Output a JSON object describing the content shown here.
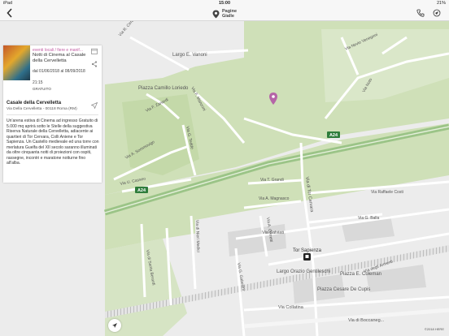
{
  "status_bar": {
    "carrier": "iPad",
    "time": "15:00",
    "battery": "21%"
  },
  "nav": {
    "logo_line1": "Pagine",
    "logo_line2": "Gialle"
  },
  "event_card": {
    "category": "eventi locali / fiere e manif...",
    "title": "Notti di Cinema al Casale della Cervelletta",
    "dates": "dal 01/06/2018 al 08/09/2018",
    "time": "21:15",
    "price": "GRATUITO",
    "venue_name": "Casale della Cervelletta",
    "venue_address": "Via Della Cervelletta - 00118 Roma (RM)",
    "description": "Un'arena estiva di Cinema ad ingresso Gratuito di 5.000 mq aprirà sotto le Stelle della suggestiva Riserva Naturale della Cervelletta, adiacente ai quartieri di Tor Cervara, Colli Aniene e Tor Sapienza. Un Castello medievale ed una torre con merlatura Guelfa del XII secolo saranno illuminati da oltre cinquanta notti di proiezioni con ospiti, rassegne, incontri e maratone notturne fino all'alba."
  },
  "map": {
    "labels": {
      "largo_vanoni": "Largo E. Vanoni",
      "piazza_loriedo": "Piazza Camillo Loriedo",
      "via_manzoni": "Via F. Manzoni",
      "via_zanardi": "Via F. Zanardi",
      "via_cerca": "Via R. Cerca",
      "via_sommovigo": "Via A. Sommovigo",
      "via_casseo": "Via U. Casseo",
      "via_tedde": "Via G. Tedde",
      "a24_right": "A24",
      "a24_left": "A24",
      "via_grandi": "Via T. Grandi",
      "via_magnasco": "Via A. Magnasco",
      "via_tor_cervara": "Via di Tor Cervara",
      "via_raffaele_costi": "Via Raffaele Costi",
      "via_salviati": "Via Salviati",
      "via_balla": "Via G. Balla",
      "via_sapienza": "Tor Sapienza",
      "largo_gentileschi": "Largo Orazio Gentileschi",
      "piazza_coleman": "Piazza E. Coleman",
      "piazza_de_cupis": "Piazza Cesare De Cupis",
      "via_collatina": "Via Collatina",
      "via_boccanegra": "Via di Boccaneg...",
      "via_gabellini": "Via G. Gabellini",
      "via_medici": "Via di Nieri Medici",
      "via_berardi": "Via di Santa Berardi",
      "via_degli_armenti": "Via degli Armenti",
      "via_cerretti": "Via A. Cerretti",
      "via_nevio": "Via Nevio Venegoni",
      "via_noto": "Via Noto"
    },
    "copyright": "©2018 HERE",
    "colors": {
      "green": "#cfe0b8",
      "urban": "#ececec",
      "road": "#ffffff",
      "highway": "#a5cc8f",
      "pin": "#b565a7",
      "buildings": "#d5d5d5"
    }
  },
  "icons": {
    "back": "chevron-left-icon",
    "phone": "phone-icon",
    "share": "share-icon",
    "calendar": "calendar-icon",
    "directions": "navigation-arrow-icon",
    "map_pin": "map-pin-icon",
    "compass": "compass-icon"
  }
}
